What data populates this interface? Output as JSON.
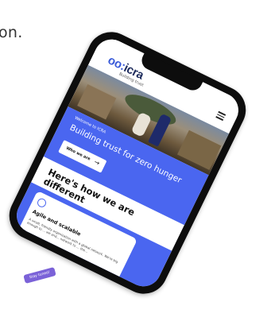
{
  "background": {
    "caption_fragment": "on."
  },
  "header": {
    "logo_text": "icra",
    "tagline": "Building trust",
    "menu_icon": "hamburger-icon"
  },
  "hero": {
    "eyebrow": "Welcome to ICRA",
    "title": "Building trust for zero hunger",
    "cta_label": "Who we are",
    "cta_icon": "arrow-right-icon"
  },
  "section": {
    "title": "Here's how we are different"
  },
  "card": {
    "icon": "circle-icon",
    "title": "Agile and scalable",
    "text": "A small, friendly organization with a global network. We're big enough to ... we and... network to ... the..."
  },
  "floating_badge": {
    "label": "Stay tuned!"
  },
  "colors": {
    "accent_blue": "#4a66f0",
    "badge_purple": "#7b62d8",
    "logo_navy": "#1d2b5c"
  }
}
